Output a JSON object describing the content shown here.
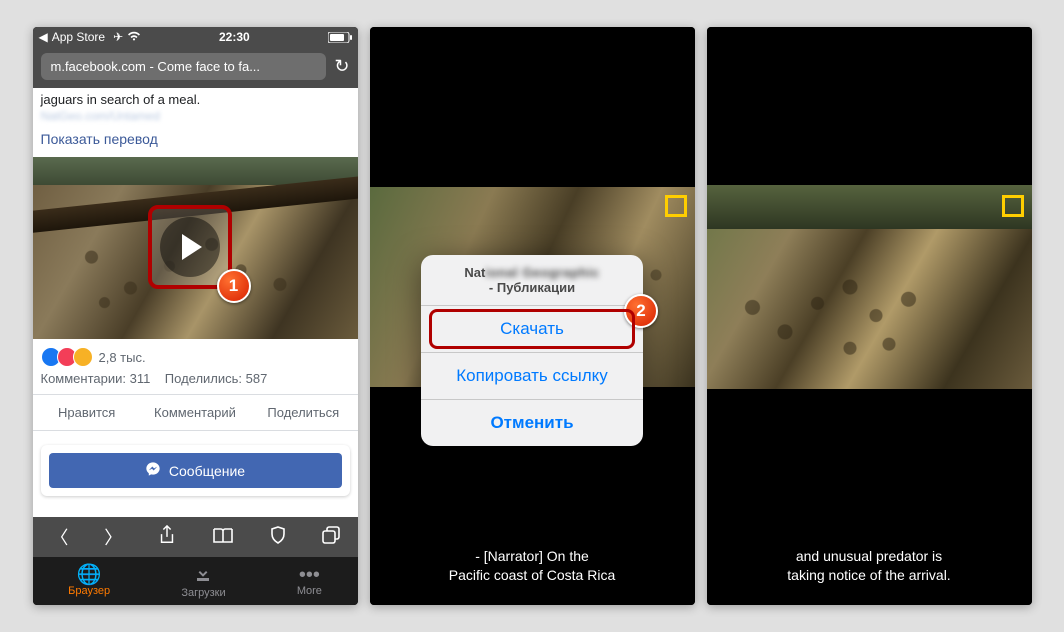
{
  "status_bar": {
    "back_label": "App Store",
    "time": "22:30"
  },
  "url_bar": {
    "text": "m.facebook.com - Come face to fa..."
  },
  "post": {
    "caption_tail": "jaguars in search of a meal.",
    "blurred_link": "NatGeo.com/Untamed",
    "translate": "Показать перевод",
    "reactions_count": "2,8 тыс.",
    "comments_label": "Комментарии: 311",
    "shares_label": "Поделились: 587",
    "like_action": "Нравится",
    "comment_action": "Комментарий",
    "share_action": "Поделиться",
    "message_button": "Сообщение"
  },
  "callouts": {
    "one": "1",
    "two": "2"
  },
  "tabbar": {
    "browser": "Браузер",
    "downloads": "Загрузки",
    "more": "More"
  },
  "action_sheet": {
    "title_visible_prefix": "Nat",
    "title_blurred": "ional Geographic",
    "title_line2": "- Публикации",
    "download": "Скачать",
    "copy_link": "Копировать ссылку",
    "cancel": "Отменить"
  },
  "subtitles": {
    "panel2_line1": "- [Narrator] On the",
    "panel2_line2": "Pacific coast of Costa Rica",
    "panel3_line1": "and unusual predator is",
    "panel3_line2": "taking notice of the arrival."
  }
}
